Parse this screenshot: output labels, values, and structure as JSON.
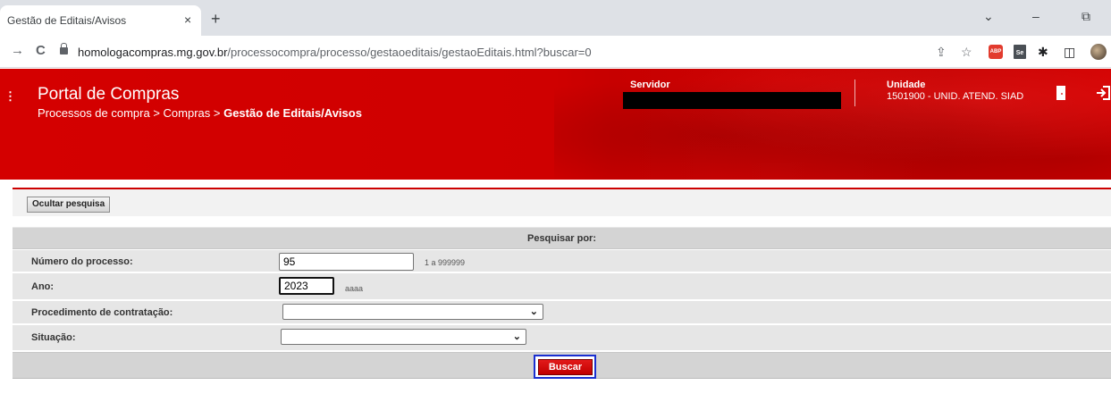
{
  "browser": {
    "tab_title": "Gestão de Editais/Avisos",
    "tab_close": "×",
    "new_tab": "+",
    "url_host": "homologacompras.mg.gov.br",
    "url_path": "/processocompra/processo/gestaoeditais/gestaoEditais.html?buscar=0",
    "window_controls": {
      "dropdown": "⌄",
      "minimize": "–",
      "restore": "⧉"
    },
    "nav": {
      "back": "→",
      "reload": "C"
    },
    "toolbar_icons": {
      "share": "⇪",
      "bookmark": "☆",
      "abp": "ABP",
      "se": "Se",
      "extensions": "✱",
      "sidepanel": "◫"
    }
  },
  "header": {
    "menu_icon": "⋮",
    "title": "Portal de Compras",
    "breadcrumb_prefix": "Processos de compra > Compras > ",
    "breadcrumb_current": "Gestão de Editais/Avisos",
    "servidor_label": "Servidor",
    "unidade_label": "Unidade",
    "unidade_value": "1501900 - UNID. ATEND. SIAD",
    "brand_color": "#d40000"
  },
  "search": {
    "hide_button": "Ocultar pesquisa",
    "section_title": "Pesquisar por:",
    "fields": {
      "numero": {
        "label": "Número do processo:",
        "value": "95",
        "hint": "1 a 999999"
      },
      "ano": {
        "label": "Ano:",
        "value": "2023",
        "hint": "aaaa"
      },
      "procedimento": {
        "label": "Procedimento de contratação:",
        "value": ""
      },
      "situacao": {
        "label": "Situação:",
        "value": ""
      }
    },
    "submit_button": "Buscar",
    "submit_highlight_color": "#1a2fd0"
  }
}
